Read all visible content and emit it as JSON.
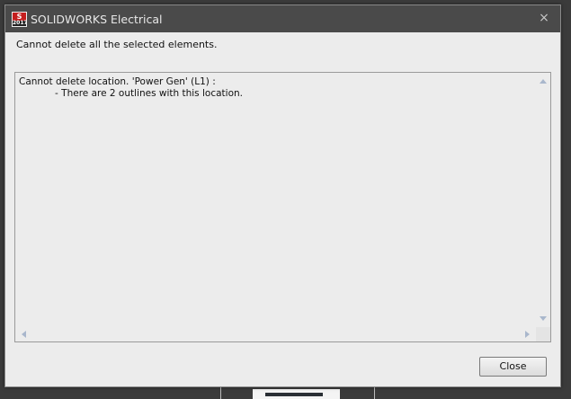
{
  "window": {
    "title": "SOLIDWORKS Electrical",
    "icon": "solidworks-electrical-2017-icon",
    "icon_text_top": "S",
    "icon_text_year": "2017",
    "close_glyph": "×"
  },
  "dialog": {
    "message": "Cannot delete all the selected elements.",
    "details": "Cannot delete location. 'Power Gen' (L1) :\n            - There are 2 outlines with this location.",
    "close_button_label": "Close"
  },
  "colors": {
    "titlebar": "#4a4a4a",
    "dialog_bg": "#ececec",
    "icon_red": "#c41e1e",
    "scroll_arrow": "#a9b7cc"
  }
}
